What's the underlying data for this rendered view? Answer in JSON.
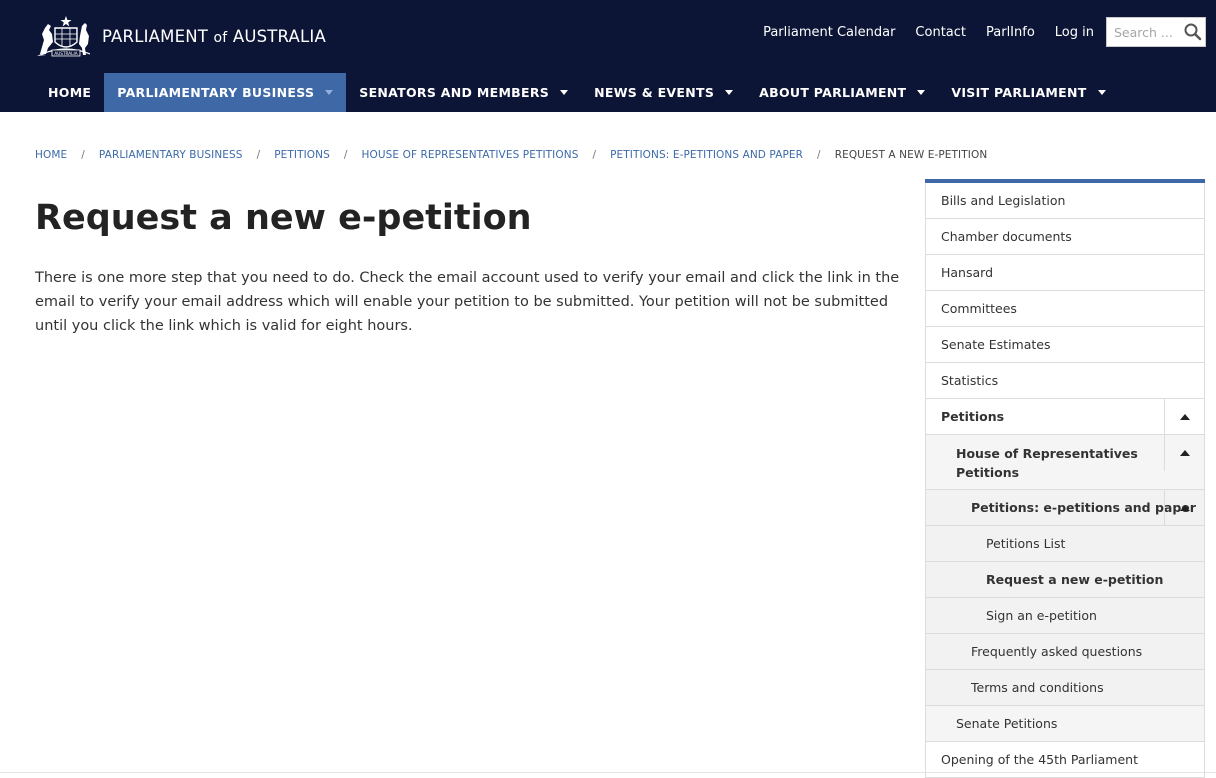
{
  "header": {
    "logo_text_main": "PARLIAMENT",
    "logo_text_of": "of",
    "logo_text_country": "AUSTRALIA",
    "crest_banner": "AUSTRALIA",
    "utility_links": [
      "Parliament Calendar",
      "Contact",
      "ParlInfo",
      "Log in"
    ],
    "search_placeholder": "Search ...",
    "nav": [
      {
        "label": "HOME",
        "dropdown": false,
        "active": false
      },
      {
        "label": "PARLIAMENTARY BUSINESS",
        "dropdown": true,
        "active": true
      },
      {
        "label": "SENATORS AND MEMBERS",
        "dropdown": true,
        "active": false
      },
      {
        "label": "NEWS & EVENTS",
        "dropdown": true,
        "active": false
      },
      {
        "label": "ABOUT PARLIAMENT",
        "dropdown": true,
        "active": false
      },
      {
        "label": "VISIT PARLIAMENT",
        "dropdown": true,
        "active": false
      }
    ]
  },
  "breadcrumb": {
    "links": [
      "HOME",
      "PARLIAMENTARY BUSINESS",
      "PETITIONS",
      "HOUSE OF REPRESENTATIVES PETITIONS",
      "PETITIONS: E-PETITIONS AND PAPER"
    ],
    "separator": "/",
    "current": "REQUEST A NEW E-PETITION"
  },
  "main": {
    "title": "Request a new e-petition",
    "body": "There is one more step that you need to do. Check the email account used to verify your email and click the link in the email to verify your email address which will enable your petition to be submitted. Your petition will not be submitted until you click the link which is valid for eight hours."
  },
  "sidebar": {
    "items": [
      {
        "label": "Bills and Legislation"
      },
      {
        "label": "Chamber documents"
      },
      {
        "label": "Hansard"
      },
      {
        "label": "Committees"
      },
      {
        "label": "Senate Estimates"
      },
      {
        "label": "Statistics"
      },
      {
        "label": "Petitions"
      },
      {
        "label": "House of Representatives Petitions"
      },
      {
        "label": "Petitions: e-petitions and paper"
      },
      {
        "label": "Petitions List"
      },
      {
        "label": "Request a new e-petition"
      },
      {
        "label": "Sign an e-petition"
      },
      {
        "label": "Frequently asked questions"
      },
      {
        "label": "Terms and conditions"
      },
      {
        "label": "Senate Petitions"
      },
      {
        "label": "Opening of the 45th Parliament"
      }
    ]
  },
  "colors": {
    "header_bg": "#0d1536",
    "nav_active_bg": "#3f68a6",
    "link": "#3b6aa8",
    "sidebar_accent": "#3f68a6"
  }
}
